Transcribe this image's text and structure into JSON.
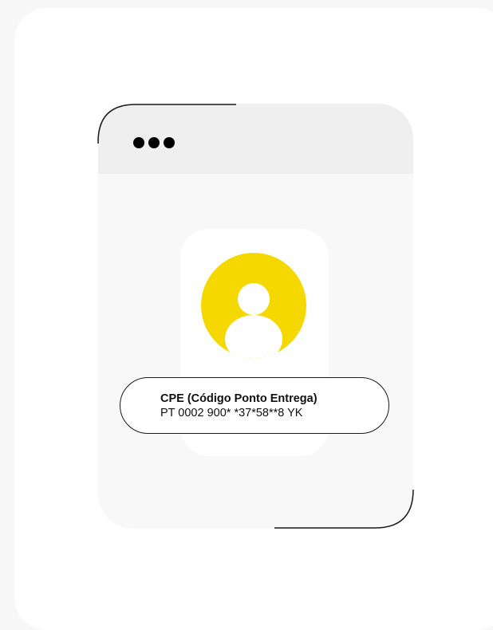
{
  "cpe_card": {
    "title": "CPE (Código Ponto Entrega)",
    "code": "PT 0002 900* *37*58**8 YK"
  },
  "icons": {
    "window_controls": "three-dots-icon",
    "avatar": "user-avatar-icon"
  },
  "colors": {
    "background": "#f7f7f7",
    "card": "#ffffff",
    "window_body": "#f8f8f8",
    "titlebar": "#efefef",
    "avatar_accent": "#f5d800",
    "outline": "#1a1a1a"
  }
}
